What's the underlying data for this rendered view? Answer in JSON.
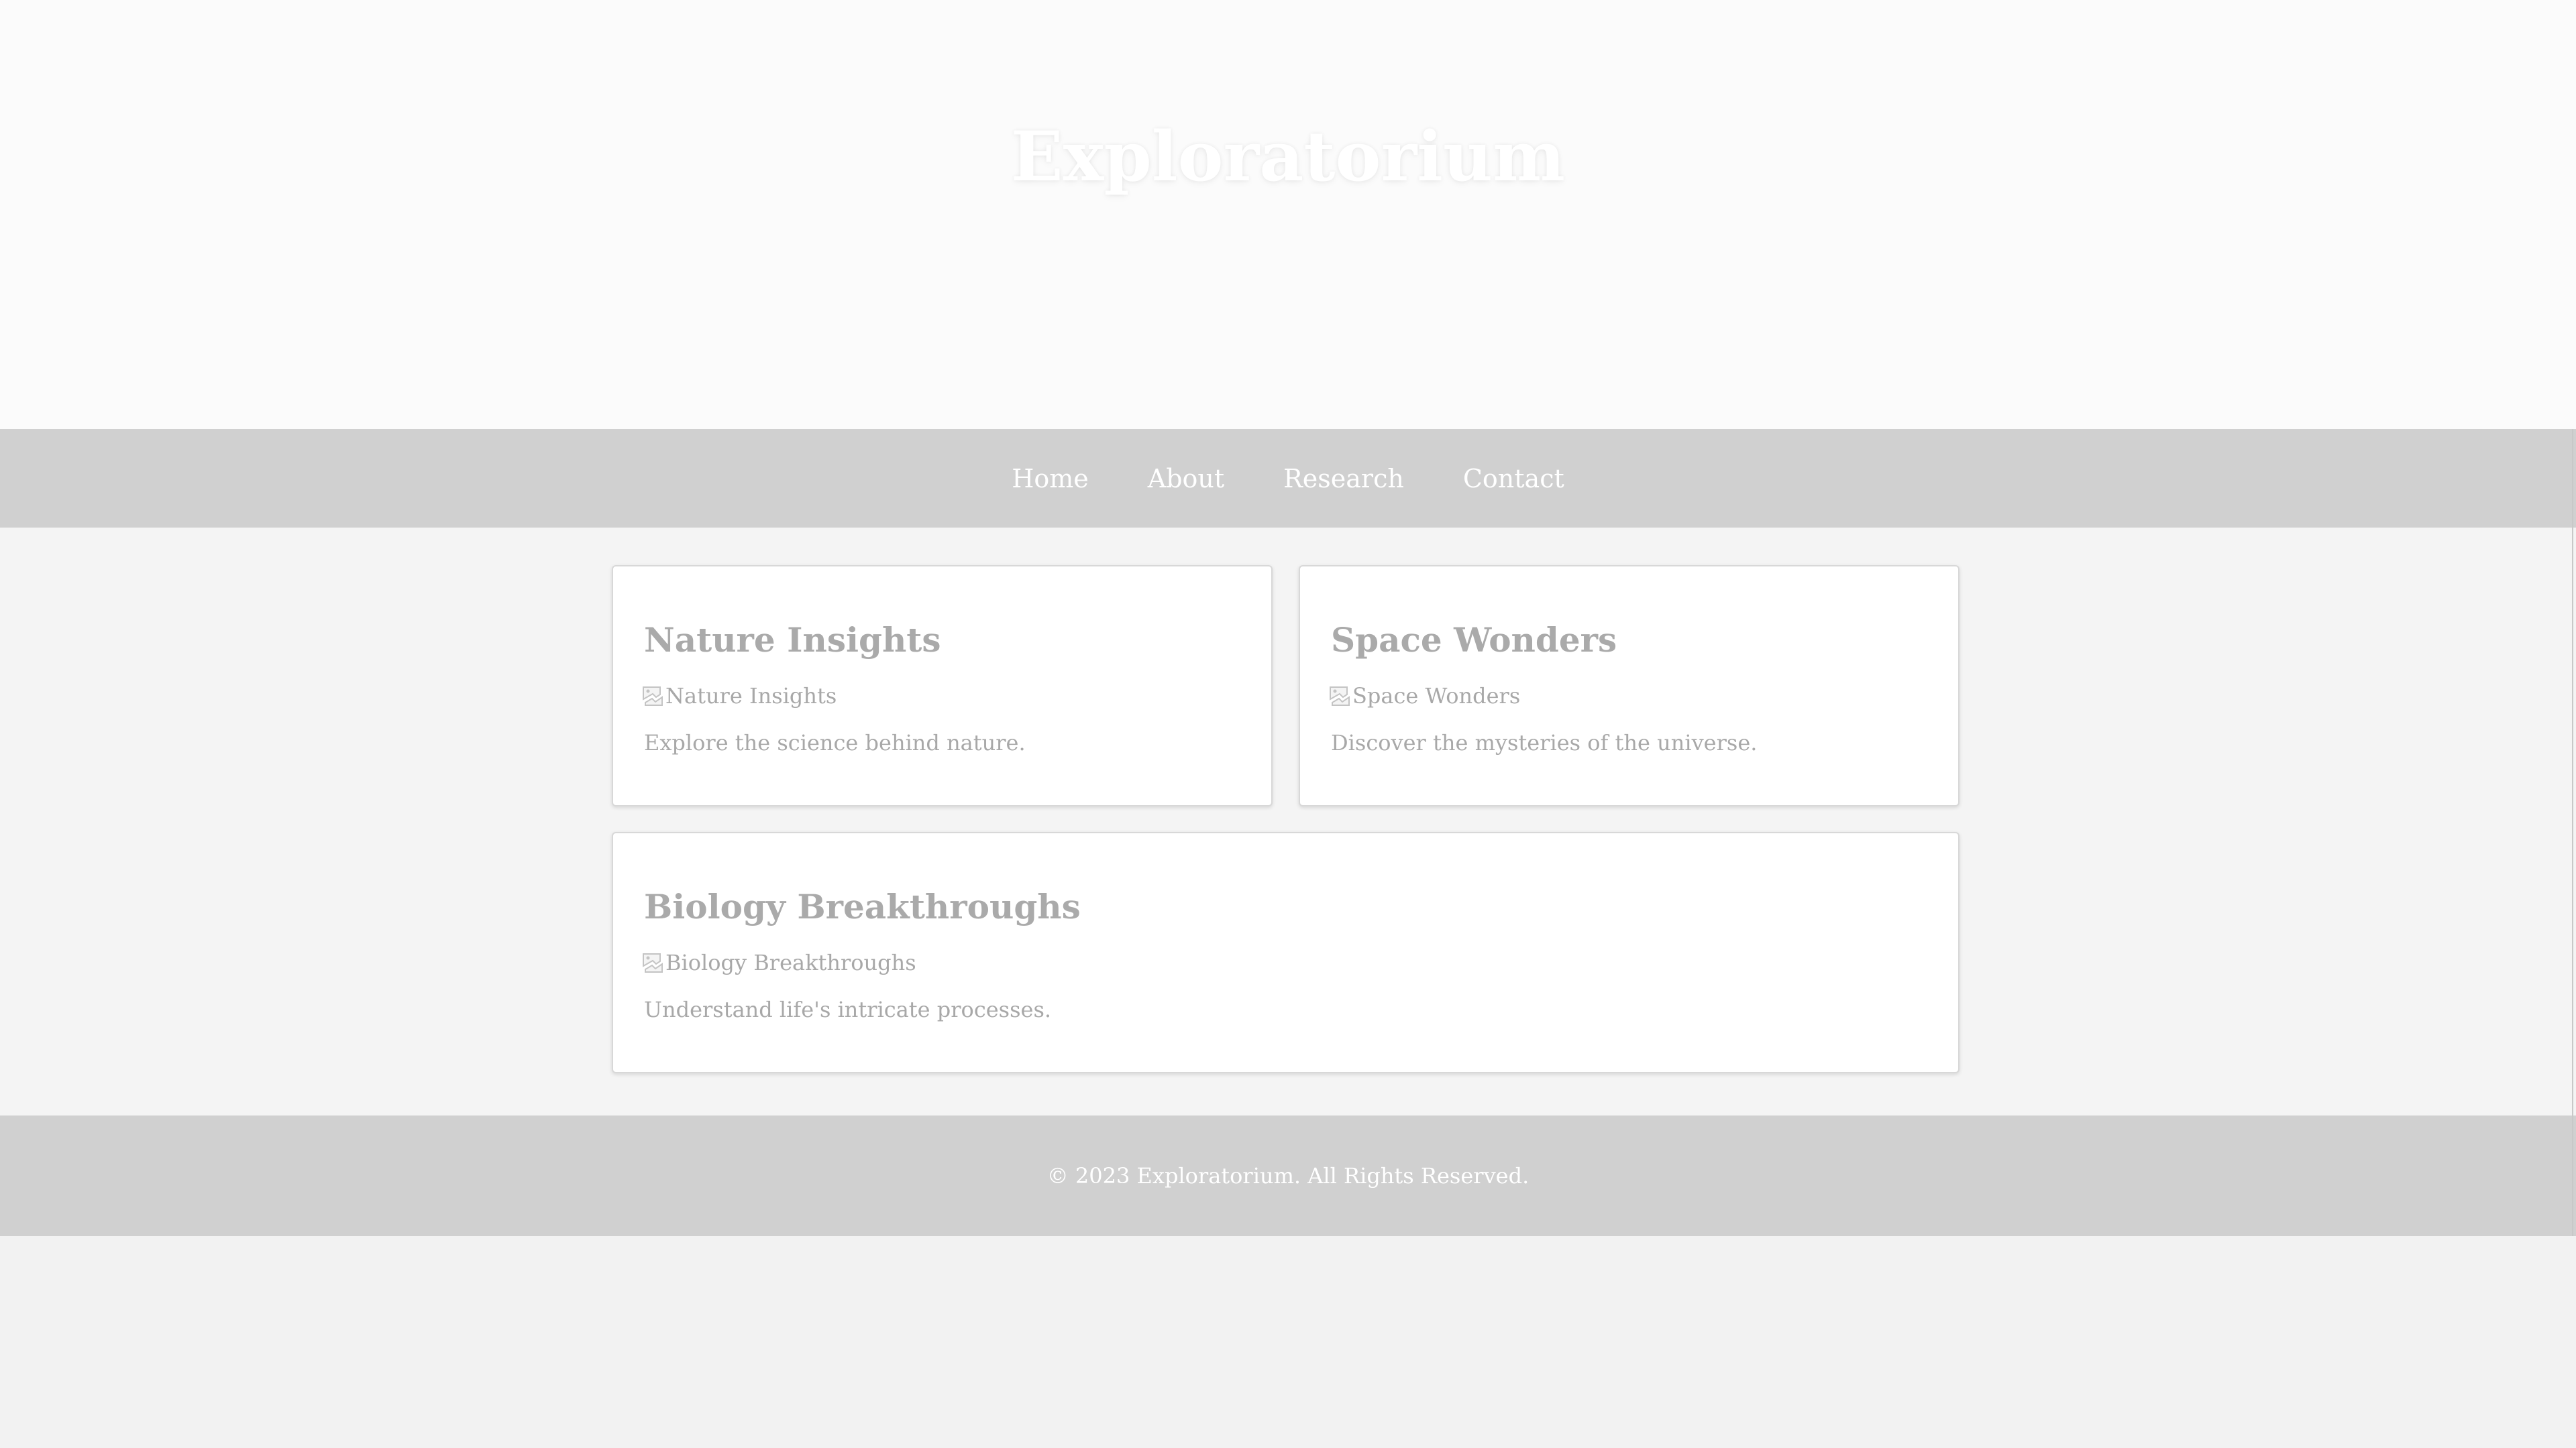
{
  "header": {
    "title": "Exploratorium"
  },
  "nav": {
    "items": [
      {
        "label": "Home"
      },
      {
        "label": "About"
      },
      {
        "label": "Research"
      },
      {
        "label": "Contact"
      }
    ]
  },
  "cards": [
    {
      "title": "Nature Insights",
      "image_alt": "Nature Insights",
      "description": "Explore the science behind nature."
    },
    {
      "title": "Space Wonders",
      "image_alt": "Space Wonders",
      "description": "Discover the mysteries of the universe."
    },
    {
      "title": "Biology Breakthroughs",
      "image_alt": "Biology Breakthroughs",
      "description": "Understand life's intricate processes."
    }
  ],
  "footer": {
    "text": "© 2023 Exploratorium. All Rights Reserved."
  }
}
